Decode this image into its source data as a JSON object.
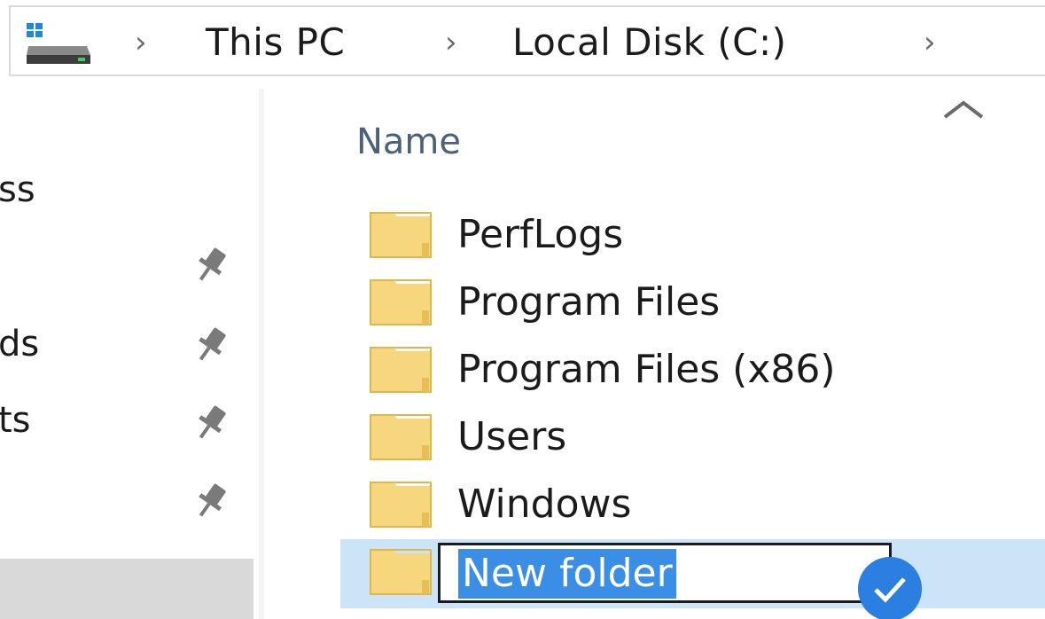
{
  "address_bar": {
    "crumbs": [
      "This PC",
      "Local Disk (C:)"
    ],
    "separator": "›",
    "icon": "drive-icon"
  },
  "nav_pane": {
    "items": [
      {
        "label": "ss",
        "pinned": false
      },
      {
        "label": "",
        "pinned": true
      },
      {
        "label": "ds",
        "pinned": true
      },
      {
        "label": "ts",
        "pinned": true
      },
      {
        "label": "",
        "pinned": true
      }
    ],
    "pin_icon": "pin-icon"
  },
  "file_list": {
    "column_header": "Name",
    "sort_indicator": "chevron-up-icon",
    "rows": [
      {
        "name": "PerfLogs",
        "icon": "folder-icon"
      },
      {
        "name": "Program Files",
        "icon": "folder-icon"
      },
      {
        "name": "Program Files (x86)",
        "icon": "folder-icon"
      },
      {
        "name": "Users",
        "icon": "folder-icon"
      },
      {
        "name": "Windows",
        "icon": "folder-icon"
      }
    ],
    "editing_row": {
      "value": "New folder",
      "icon": "folder-icon",
      "confirm_icon": "checkmark-icon"
    }
  },
  "colors": {
    "selection": "#cce4f7",
    "text_highlight": "#3a8ee6",
    "folder": "#f7d77d",
    "header_text": "#4c607a",
    "accent": "#2a7fe0"
  }
}
